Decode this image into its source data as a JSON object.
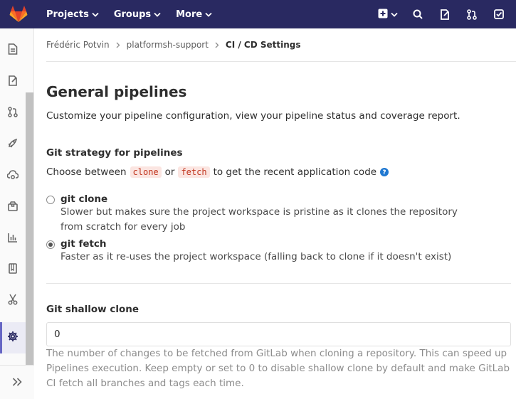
{
  "navbar": {
    "projects_label": "Projects",
    "groups_label": "Groups",
    "more_label": "More",
    "icons": [
      "plus-icon",
      "search-icon",
      "issues-icon",
      "merge-request-icon",
      "todo-icon"
    ]
  },
  "sidebar": {
    "items": [
      "overview-icon",
      "issues-icon",
      "merge-request-icon",
      "ci-cd-icon",
      "operations-icon",
      "packages-icon",
      "analytics-icon",
      "wiki-icon",
      "snippets-icon",
      "settings-icon"
    ],
    "active": "settings-icon"
  },
  "breadcrumb": {
    "owner": "Frédéric Potvin",
    "project": "platformsh-support",
    "current": "CI / CD Settings"
  },
  "section": {
    "title": "General pipelines",
    "description": "Customize your pipeline configuration, view your pipeline status and coverage report."
  },
  "git_strategy": {
    "label": "Git strategy for pipelines",
    "intro_prefix": "Choose between",
    "code_clone": "clone",
    "intro_or": "or",
    "code_fetch": "fetch",
    "intro_suffix": "to get the recent application code",
    "options": [
      {
        "title": "git clone",
        "help": "Slower but makes sure the project workspace is pristine as it clones the repository from scratch for every job",
        "checked": false
      },
      {
        "title": "git fetch",
        "help": "Faster as it re-uses the project workspace (falling back to clone if it doesn't exist)",
        "checked": true
      }
    ]
  },
  "shallow_clone": {
    "label": "Git shallow clone",
    "value": "0",
    "help": "The number of changes to be fetched from GitLab when cloning a repository. This can speed up Pipelines execution. Keep empty or set to 0 to disable shallow clone by default and make GitLab CI fetch all branches and tags each time."
  },
  "colors": {
    "navbar": "#292961",
    "active_accent": "#6666c4",
    "code_text": "#c0341d",
    "code_bg": "#fbe5e1",
    "help_icon": "#1f78d1"
  }
}
